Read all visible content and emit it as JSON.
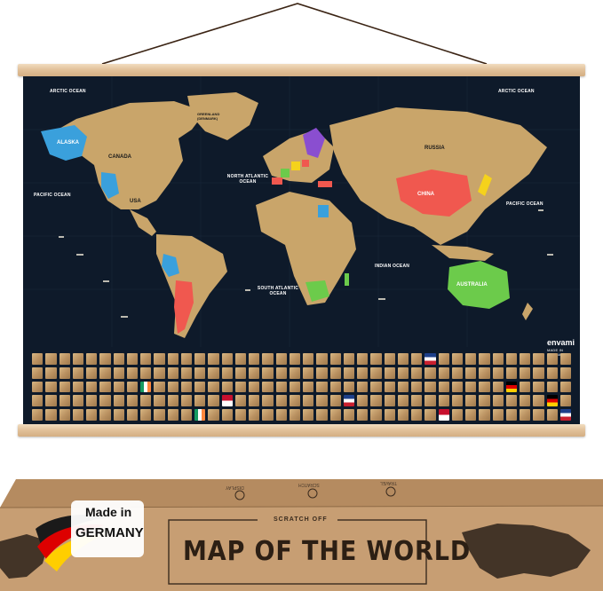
{
  "poster": {
    "oceans": {
      "arctic_left": "ARCTIC OCEAN",
      "arctic_right": "ARCTIC OCEAN",
      "pacific_left": "PACIFIC OCEAN",
      "pacific_right": "PACIFIC OCEAN",
      "north_atlantic": "NORTH ATLANTIC OCEAN",
      "south_atlantic": "SOUTH ATLANTIC OCEAN",
      "indian": "INDIAN OCEAN"
    },
    "countries": {
      "alaska": "ALASKA",
      "canada": "CANADA",
      "usa": "USA",
      "russia": "RUSSIA",
      "china": "CHINA",
      "australia": "AUSTRALIA",
      "greenland": "GREENLAND (DENMARK)"
    },
    "brand": "envami",
    "brand_sub": "MADE IN GERMANY"
  },
  "box": {
    "scratch_label": "SCRATCH OFF",
    "title": "MAP OF THE WORLD",
    "badge_line1": "Made in",
    "badge_line2": "GERMANY",
    "flap_items": [
      "TRAVEL",
      "SCRATCH",
      "DISPLAY"
    ]
  },
  "colors": {
    "ocean": "#0e1a2a",
    "land_gold": "#c9a56a",
    "wood": "#e2c29b",
    "kraft": "#c79e73",
    "scratched_blue": "#3aa0dc",
    "scratched_red": "#f0584f",
    "scratched_green": "#6ccb4b",
    "scratched_yellow": "#f5d21c",
    "scratched_purple": "#8a4ed0"
  }
}
